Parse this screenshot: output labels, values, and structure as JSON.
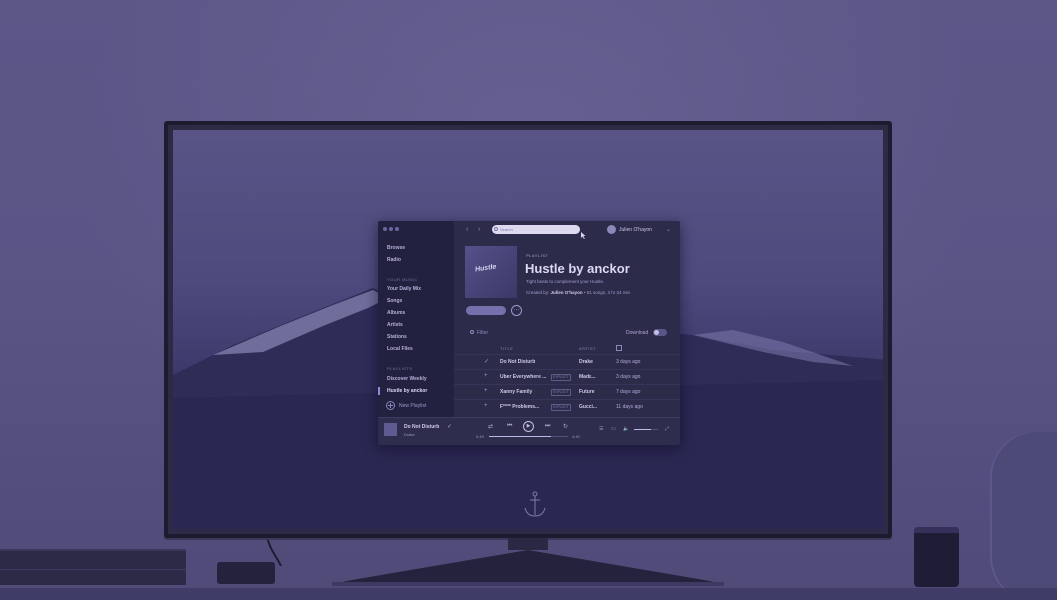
{
  "app": {
    "sidebar": {
      "browse": "Browse",
      "radio": "Radio",
      "your_music_heading": "YOUR MUSIC",
      "your_music": [
        "Your Daily Mix",
        "Songs",
        "Albums",
        "Artists",
        "Stations",
        "Local Files"
      ],
      "playlists_heading": "PLAYLISTS",
      "playlists": [
        "Discover Weekly",
        "Hustle by anckor"
      ],
      "active_playlist": "Hustle by anckor",
      "new_playlist": "New Playlist"
    },
    "topbar": {
      "back_icon": "chevron-left-icon",
      "forward_icon": "chevron-right-icon",
      "search_placeholder": "Search",
      "user_name": "Julien O'hayon",
      "user_menu_icon": "chevron-down-icon"
    },
    "playlist": {
      "kicker": "PLAYLIST",
      "title": "Hustle by anckor",
      "cover_text": "Hustle",
      "description": "Tight beats to complement your Hustle.",
      "meta_prefix": "Created by:",
      "meta_owner": "Julien O'hayon",
      "meta_suffix": "• 51 songs, 3 hr 24 min",
      "more_label": "···"
    },
    "tracklist": {
      "filter_placeholder": "Filter",
      "download_label": "Download",
      "download_enabled": false,
      "col_title": "TITLE",
      "col_artist": "ARTIST",
      "date_icon": "calendar-icon",
      "rows": [
        {
          "mark": "✓",
          "title": "Do Not Disturb",
          "explicit": false,
          "explicit_label": "",
          "artist": "Drake",
          "added": "3 days ago"
        },
        {
          "mark": "+",
          "title": "Uber Everywhere ...",
          "explicit": true,
          "explicit_label": "EXPLICIT",
          "artist": "Madε...",
          "added": "3 days ago"
        },
        {
          "mark": "+",
          "title": "Xanny Family",
          "explicit": true,
          "explicit_label": "EXPLICIT",
          "artist": "Future",
          "added": "7 days ago"
        },
        {
          "mark": "+",
          "title": "F**** Problems...",
          "explicit": true,
          "explicit_label": "EXPLICIT",
          "artist": "Gucci...",
          "added": "11 days ago"
        }
      ]
    },
    "player": {
      "now_playing_title": "Do Not Disturb",
      "now_playing_artist": "Drake",
      "saved_icon": "check-icon",
      "shuffle_icon": "shuffle-icon",
      "prev_icon": "previous-icon",
      "play_icon": "play-icon",
      "next_icon": "next-icon",
      "repeat_icon": "repeat-icon",
      "elapsed": "0:43",
      "duration": "4:40",
      "progress": 0.78,
      "volume": 0.7
    }
  },
  "colors": {
    "overlay_tint": "#5a5585",
    "app_bg": "#2d2b4a",
    "sidebar_bg": "#232140"
  }
}
